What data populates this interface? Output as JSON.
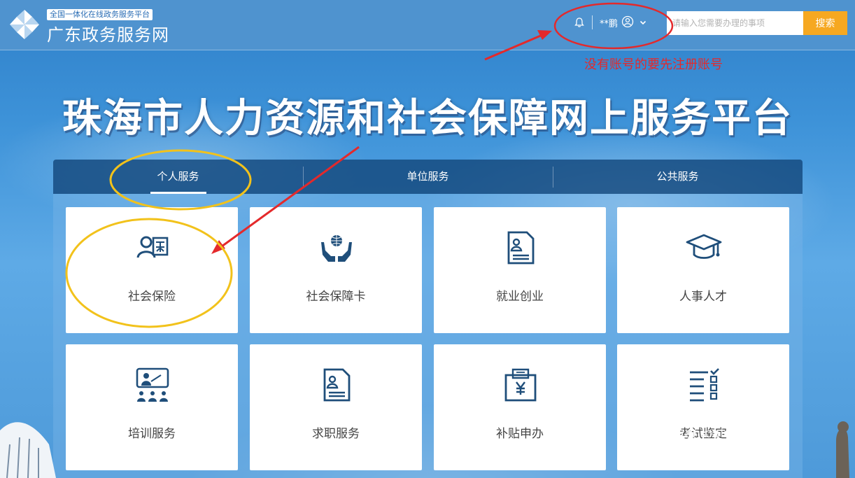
{
  "header": {
    "logo_subtitle": "全国一体化在线政务服务平台",
    "logo_title": "广东政务服务网",
    "username": "**鹏",
    "search_placeholder": "请输入您需要办理的事项",
    "search_button": "搜索"
  },
  "annotation": {
    "note": "没有账号的要先注册账号",
    "color": "#e4292b",
    "highlight_color": "#f2c21b"
  },
  "page_title": "珠海市人力资源和社会保障网上服务平台",
  "tabs": [
    {
      "label": "个人服务",
      "active": true
    },
    {
      "label": "单位服务",
      "active": false
    },
    {
      "label": "公共服务",
      "active": false
    }
  ],
  "cards": [
    {
      "label": "社会保险",
      "icon": "person-insurance-icon"
    },
    {
      "label": "社会保障卡",
      "icon": "hands-globe-icon"
    },
    {
      "label": "就业创业",
      "icon": "resume-document-icon"
    },
    {
      "label": "人事人才",
      "icon": "graduation-cap-icon"
    },
    {
      "label": "培训服务",
      "icon": "presentation-icon"
    },
    {
      "label": "求职服务",
      "icon": "job-document-icon"
    },
    {
      "label": "补贴申办",
      "icon": "yuan-subsidy-icon"
    },
    {
      "label": "考试鉴定",
      "icon": "checklist-icon"
    }
  ],
  "watermark": {
    "text": "Bai 经验",
    "url": "jingyan.baidu.com"
  },
  "colors": {
    "icon": "#1f4e7a",
    "accent": "#f6a821",
    "tab_bg": "#14487d"
  }
}
